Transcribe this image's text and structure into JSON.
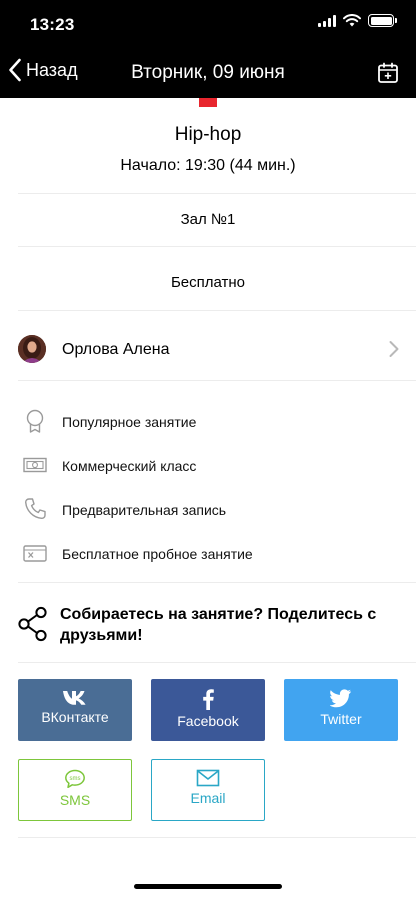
{
  "status_bar": {
    "time": "13:23"
  },
  "nav": {
    "back_label": "Назад",
    "title": "Вторник, 09 июня"
  },
  "colors": {
    "accent": "#e8262e",
    "vk": "#4a6d95",
    "facebook": "#3b5898",
    "twitter": "#41a4f0",
    "sms": "#7dc63b",
    "email": "#2aa7c6"
  },
  "class": {
    "title": "Hip-hop",
    "start": "Начало: 19:30 (44 мин.)",
    "hall": "Зал №1",
    "price": "Бесплатно"
  },
  "trainer": {
    "name": "Орлова Алена"
  },
  "features": [
    {
      "icon": "award-icon",
      "label": "Популярное занятие"
    },
    {
      "icon": "banknote-icon",
      "label": "Коммерческий класс"
    },
    {
      "icon": "phone-icon",
      "label": "Предварительная запись"
    },
    {
      "icon": "free-trial-icon",
      "label": "Бесплатное пробное занятие"
    }
  ],
  "share": {
    "prompt": "Собираетесь на занятие? Поделитесь с друзьями!",
    "buttons": {
      "vk": "ВКонтакте",
      "facebook": "Facebook",
      "twitter": "Twitter",
      "sms": "SMS",
      "sms_icon_text": "sms",
      "email": "Email"
    }
  }
}
